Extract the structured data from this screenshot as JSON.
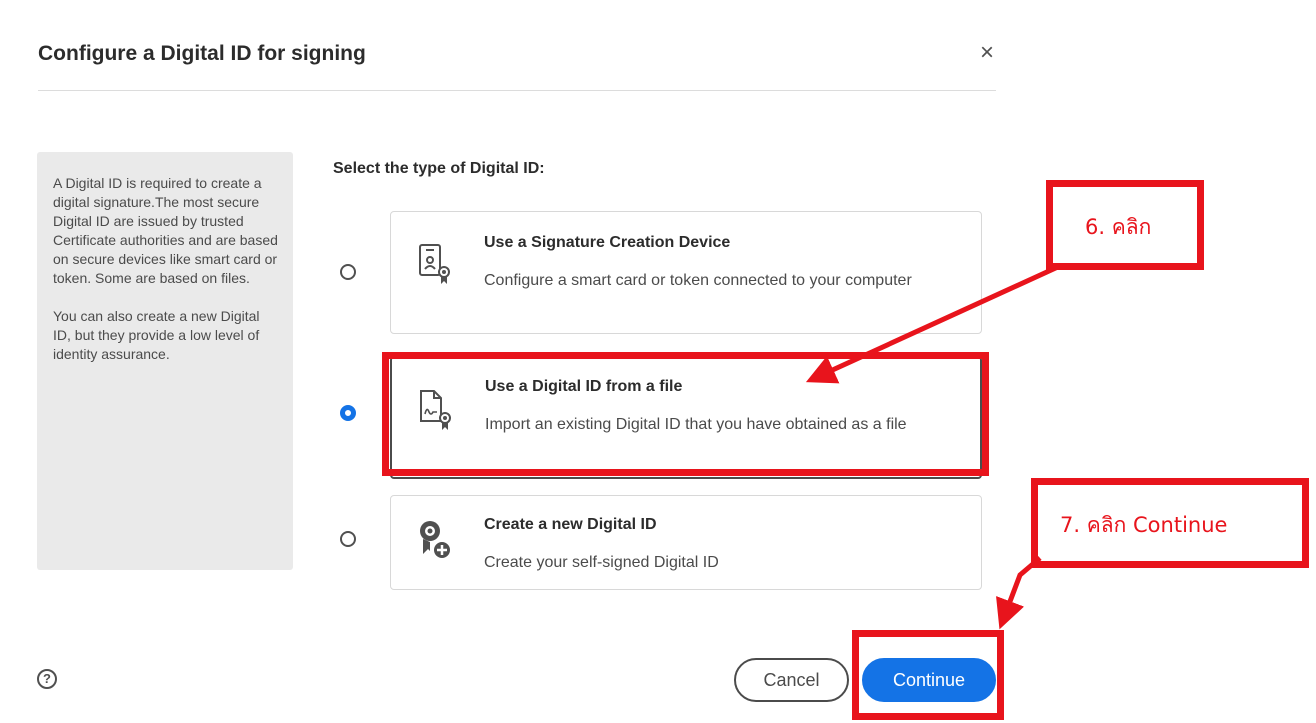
{
  "dialog": {
    "title": "Configure a Digital ID for signing",
    "close_label": "×"
  },
  "info": {
    "paragraph1": "A Digital ID is required to create a digital signature.The most secure Digital ID are issued by trusted Certificate authorities and are based on secure devices like smart card or token. Some are based on files.",
    "paragraph2": "You can also create a new Digital ID, but they provide a low level of identity assurance."
  },
  "select_heading": "Select the type of Digital ID:",
  "options": [
    {
      "title": "Use a Signature Creation Device",
      "desc": "Configure a smart card or token connected to your computer",
      "icon": "signature-device-icon",
      "selected": false
    },
    {
      "title": "Use a Digital ID from a file",
      "desc": "Import an existing Digital ID that you have obtained as a file",
      "icon": "digital-id-file-icon",
      "selected": true
    },
    {
      "title": "Create a new Digital ID",
      "desc": "Create your self-signed Digital ID",
      "icon": "new-digital-id-icon",
      "selected": false
    }
  ],
  "footer": {
    "help_icon": "?",
    "cancel_label": "Cancel",
    "continue_label": "Continue"
  },
  "annotations": {
    "step6": "6. คลิก",
    "step7": "7. คลิก Continue",
    "color": "#e8141c"
  },
  "colors": {
    "accent": "#1473e6"
  }
}
